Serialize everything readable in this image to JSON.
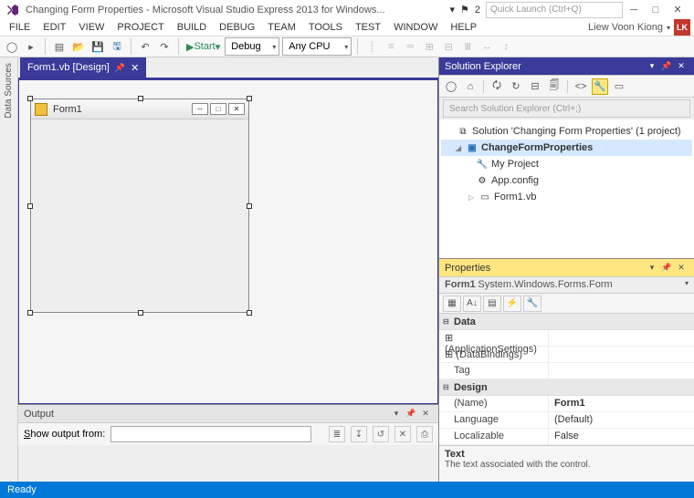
{
  "window": {
    "title": "Changing Form Properties - Microsoft Visual Studio Express 2013 for Windows...",
    "notification_count": "2",
    "quick_launch_placeholder": "Quick Launch (Ctrl+Q)"
  },
  "menu": {
    "file": "FILE",
    "edit": "EDIT",
    "view": "VIEW",
    "project": "PROJECT",
    "build": "BUILD",
    "debug": "DEBUG",
    "team": "TEAM",
    "tools": "TOOLS",
    "test": "TEST",
    "window": "WINDOW",
    "help": "HELP",
    "user_name": "Liew Voon Kiong",
    "user_initials": "LK"
  },
  "toolbar": {
    "start_label": "Start",
    "config": "Debug",
    "platform": "Any CPU"
  },
  "leftrail": {
    "data_sources": "Data Sources"
  },
  "document": {
    "tab_label": "Form1.vb [Design]",
    "form_title": "Form1"
  },
  "output": {
    "panel_title": "Output",
    "show_label": "Show output from:"
  },
  "solution_explorer": {
    "panel_title": "Solution Explorer",
    "search_placeholder": "Search Solution Explorer (Ctrl+;)",
    "solution_label": "Solution 'Changing Form Properties' (1 project)",
    "project_label": "ChangeFormProperties",
    "my_project": "My Project",
    "app_config": "App.config",
    "form1": "Form1.vb"
  },
  "properties": {
    "panel_title": "Properties",
    "object_label": "Form1 System.Windows.Forms.Form",
    "cat_data": "Data",
    "app_settings": "(ApplicationSettings)",
    "data_bindings": "(DataBindings)",
    "tag": "Tag",
    "cat_design": "Design",
    "name_label": "(Name)",
    "name_value": "Form1",
    "language_label": "Language",
    "language_value": "(Default)",
    "localizable_label": "Localizable",
    "localizable_value": "False",
    "desc_title": "Text",
    "desc_text": "The text associated with the control."
  },
  "status": {
    "ready": "Ready"
  }
}
